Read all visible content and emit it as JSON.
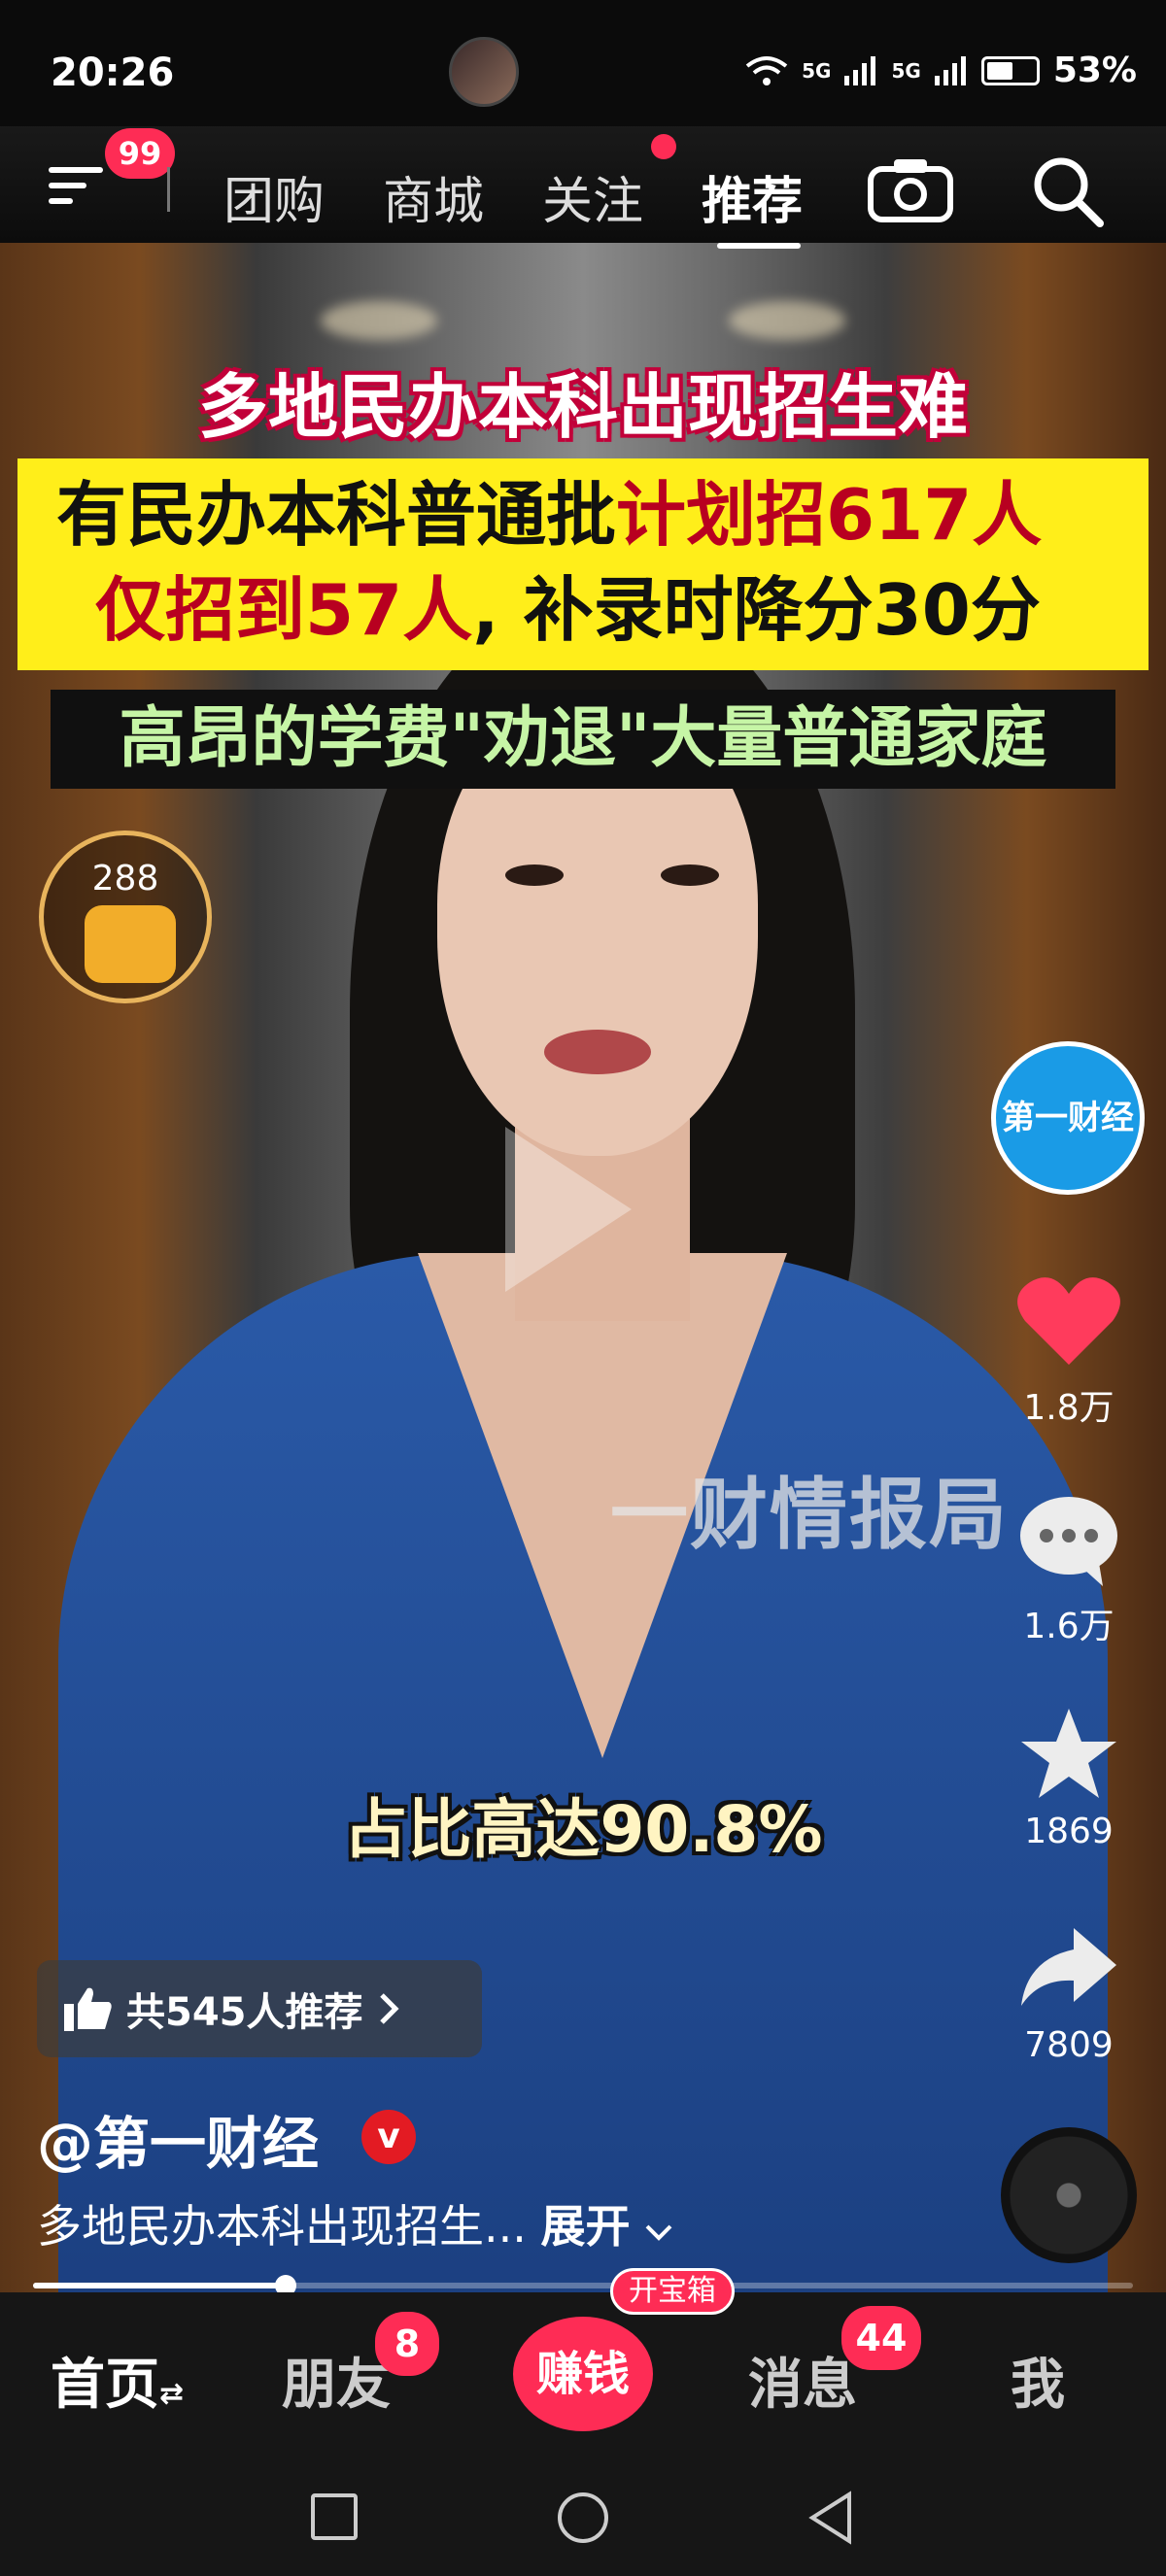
{
  "status_bar": {
    "time": "20:26",
    "signal_1": "5G",
    "signal_2": "5G",
    "battery": "53%"
  },
  "top_nav": {
    "menu_badge": "99",
    "tabs": [
      {
        "label": "团购"
      },
      {
        "label": "商城"
      },
      {
        "label": "关注"
      },
      {
        "label": "推荐"
      }
    ],
    "active_tab": "推荐",
    "icons": [
      "menu-icon",
      "camera-icon",
      "search-icon"
    ]
  },
  "video": {
    "caption_title": "多地民办本科出现招生难",
    "caption_line1_a": "有民办本科普通批",
    "caption_line1_b": "计划招617人",
    "caption_line2_a": "仅招到57人",
    "caption_line2_b": ", 补录时降分30分",
    "caption_line3": "高昂的学费\"劝退\"大量普通家庭",
    "watermark": "一财情报局",
    "subtitle": "占比高达90.8%",
    "gift_count": "288"
  },
  "right_rail": {
    "channel_logo": "第一财经",
    "likes": "1.8万",
    "comments": "1.6万",
    "favorites": "1869",
    "shares": "7809"
  },
  "info": {
    "recommend": "共545人推荐",
    "author": "@第一财经",
    "verified": "v",
    "description": "多地民办本科出现招生...",
    "expand": "展开"
  },
  "progress": 0.23,
  "bottom_tabs": {
    "home": "首页",
    "friends": "朋友",
    "friends_badge": "8",
    "earn": "赚钱",
    "treasure": "开宝箱",
    "messages": "消息",
    "messages_badge": "44",
    "me": "我"
  },
  "colors": {
    "accent": "#fe2c55",
    "caption_yellow": "#ffee1a",
    "highlight_red": "#b80020",
    "caption_green": "#c6f5a6"
  }
}
